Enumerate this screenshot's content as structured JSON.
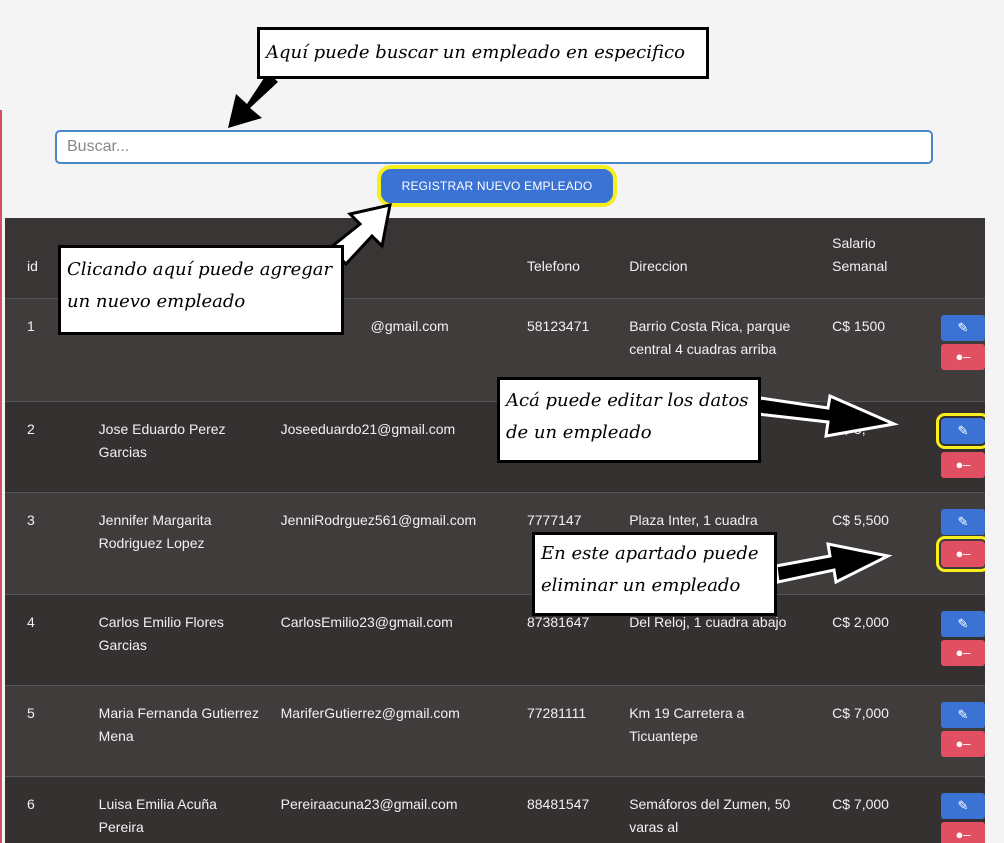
{
  "search": {
    "placeholder": "Buscar..."
  },
  "register_button": "REGISTRAR NUEVO EMPLEADO",
  "table": {
    "headers": {
      "id": "id",
      "name": "",
      "email": "",
      "phone": "Telefono",
      "address": "Direccion",
      "salary": "Salario Semanal"
    },
    "rows": [
      {
        "id": "1",
        "name": "",
        "email": "@gmail.com",
        "phone": "58123471",
        "address": "Barrio Costa Rica, parque central 4 cuadras arriba",
        "salary": "C$ 1500"
      },
      {
        "id": "2",
        "name": "Jose Eduardo Perez Garcias",
        "email": "Joseeduardo21@gmail.com",
        "phone": "",
        "address": "",
        "salary": "C$ 5,"
      },
      {
        "id": "3",
        "name": "Jennifer Margarita Rodriguez Lopez",
        "email": "JenniRodrguez561@gmail.com",
        "phone": "7777147",
        "address": "Plaza Inter, 1 cuadra",
        "salary": "C$ 5,500"
      },
      {
        "id": "4",
        "name": "Carlos Emilio Flores Garcias",
        "email": "CarlosEmilio23@gmail.com",
        "phone": "87381647",
        "address": "Del Reloj, 1 cuadra abajo",
        "salary": "C$ 2,000"
      },
      {
        "id": "5",
        "name": "Maria Fernanda Gutierrez Mena",
        "email": "MariferGutierrez@gmail.com",
        "phone": "77281111",
        "address": "Km 19 Carretera a Ticuantepe",
        "salary": "C$ 7,000"
      },
      {
        "id": "6",
        "name": "Luisa Emilia Acuña Pereira",
        "email": "Pereiraacuna23@gmail.com",
        "phone": "88481547",
        "address": "Semáforos del Zumen, 50 varas al",
        "salary": "C$ 7,000"
      }
    ]
  },
  "callouts": {
    "search": "Aquí puede buscar un empleado en especifico",
    "register": "Clicando aquí puede agregar un nuevo empleado",
    "edit": "Acá puede editar los datos de un empleado",
    "delete": "En este apartado puede eliminar un empleado"
  },
  "icons": {
    "edit": "pencil-icon",
    "delete": "user-minus-icon"
  },
  "colors": {
    "primary": "#3b73d4",
    "danger": "#e04f62",
    "highlight": "#f6ee1d",
    "table_bg": "#3a3535"
  }
}
